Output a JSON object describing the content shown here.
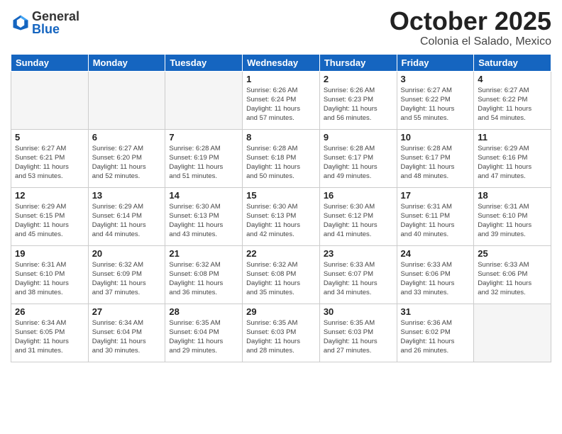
{
  "header": {
    "logo_general": "General",
    "logo_blue": "Blue",
    "month": "October 2025",
    "location": "Colonia el Salado, Mexico"
  },
  "days_of_week": [
    "Sunday",
    "Monday",
    "Tuesday",
    "Wednesday",
    "Thursday",
    "Friday",
    "Saturday"
  ],
  "weeks": [
    [
      {
        "day": "",
        "info": ""
      },
      {
        "day": "",
        "info": ""
      },
      {
        "day": "",
        "info": ""
      },
      {
        "day": "1",
        "info": "Sunrise: 6:26 AM\nSunset: 6:24 PM\nDaylight: 11 hours\nand 57 minutes."
      },
      {
        "day": "2",
        "info": "Sunrise: 6:26 AM\nSunset: 6:23 PM\nDaylight: 11 hours\nand 56 minutes."
      },
      {
        "day": "3",
        "info": "Sunrise: 6:27 AM\nSunset: 6:22 PM\nDaylight: 11 hours\nand 55 minutes."
      },
      {
        "day": "4",
        "info": "Sunrise: 6:27 AM\nSunset: 6:22 PM\nDaylight: 11 hours\nand 54 minutes."
      }
    ],
    [
      {
        "day": "5",
        "info": "Sunrise: 6:27 AM\nSunset: 6:21 PM\nDaylight: 11 hours\nand 53 minutes."
      },
      {
        "day": "6",
        "info": "Sunrise: 6:27 AM\nSunset: 6:20 PM\nDaylight: 11 hours\nand 52 minutes."
      },
      {
        "day": "7",
        "info": "Sunrise: 6:28 AM\nSunset: 6:19 PM\nDaylight: 11 hours\nand 51 minutes."
      },
      {
        "day": "8",
        "info": "Sunrise: 6:28 AM\nSunset: 6:18 PM\nDaylight: 11 hours\nand 50 minutes."
      },
      {
        "day": "9",
        "info": "Sunrise: 6:28 AM\nSunset: 6:17 PM\nDaylight: 11 hours\nand 49 minutes."
      },
      {
        "day": "10",
        "info": "Sunrise: 6:28 AM\nSunset: 6:17 PM\nDaylight: 11 hours\nand 48 minutes."
      },
      {
        "day": "11",
        "info": "Sunrise: 6:29 AM\nSunset: 6:16 PM\nDaylight: 11 hours\nand 47 minutes."
      }
    ],
    [
      {
        "day": "12",
        "info": "Sunrise: 6:29 AM\nSunset: 6:15 PM\nDaylight: 11 hours\nand 45 minutes."
      },
      {
        "day": "13",
        "info": "Sunrise: 6:29 AM\nSunset: 6:14 PM\nDaylight: 11 hours\nand 44 minutes."
      },
      {
        "day": "14",
        "info": "Sunrise: 6:30 AM\nSunset: 6:13 PM\nDaylight: 11 hours\nand 43 minutes."
      },
      {
        "day": "15",
        "info": "Sunrise: 6:30 AM\nSunset: 6:13 PM\nDaylight: 11 hours\nand 42 minutes."
      },
      {
        "day": "16",
        "info": "Sunrise: 6:30 AM\nSunset: 6:12 PM\nDaylight: 11 hours\nand 41 minutes."
      },
      {
        "day": "17",
        "info": "Sunrise: 6:31 AM\nSunset: 6:11 PM\nDaylight: 11 hours\nand 40 minutes."
      },
      {
        "day": "18",
        "info": "Sunrise: 6:31 AM\nSunset: 6:10 PM\nDaylight: 11 hours\nand 39 minutes."
      }
    ],
    [
      {
        "day": "19",
        "info": "Sunrise: 6:31 AM\nSunset: 6:10 PM\nDaylight: 11 hours\nand 38 minutes."
      },
      {
        "day": "20",
        "info": "Sunrise: 6:32 AM\nSunset: 6:09 PM\nDaylight: 11 hours\nand 37 minutes."
      },
      {
        "day": "21",
        "info": "Sunrise: 6:32 AM\nSunset: 6:08 PM\nDaylight: 11 hours\nand 36 minutes."
      },
      {
        "day": "22",
        "info": "Sunrise: 6:32 AM\nSunset: 6:08 PM\nDaylight: 11 hours\nand 35 minutes."
      },
      {
        "day": "23",
        "info": "Sunrise: 6:33 AM\nSunset: 6:07 PM\nDaylight: 11 hours\nand 34 minutes."
      },
      {
        "day": "24",
        "info": "Sunrise: 6:33 AM\nSunset: 6:06 PM\nDaylight: 11 hours\nand 33 minutes."
      },
      {
        "day": "25",
        "info": "Sunrise: 6:33 AM\nSunset: 6:06 PM\nDaylight: 11 hours\nand 32 minutes."
      }
    ],
    [
      {
        "day": "26",
        "info": "Sunrise: 6:34 AM\nSunset: 6:05 PM\nDaylight: 11 hours\nand 31 minutes."
      },
      {
        "day": "27",
        "info": "Sunrise: 6:34 AM\nSunset: 6:04 PM\nDaylight: 11 hours\nand 30 minutes."
      },
      {
        "day": "28",
        "info": "Sunrise: 6:35 AM\nSunset: 6:04 PM\nDaylight: 11 hours\nand 29 minutes."
      },
      {
        "day": "29",
        "info": "Sunrise: 6:35 AM\nSunset: 6:03 PM\nDaylight: 11 hours\nand 28 minutes."
      },
      {
        "day": "30",
        "info": "Sunrise: 6:35 AM\nSunset: 6:03 PM\nDaylight: 11 hours\nand 27 minutes."
      },
      {
        "day": "31",
        "info": "Sunrise: 6:36 AM\nSunset: 6:02 PM\nDaylight: 11 hours\nand 26 minutes."
      },
      {
        "day": "",
        "info": ""
      }
    ]
  ]
}
